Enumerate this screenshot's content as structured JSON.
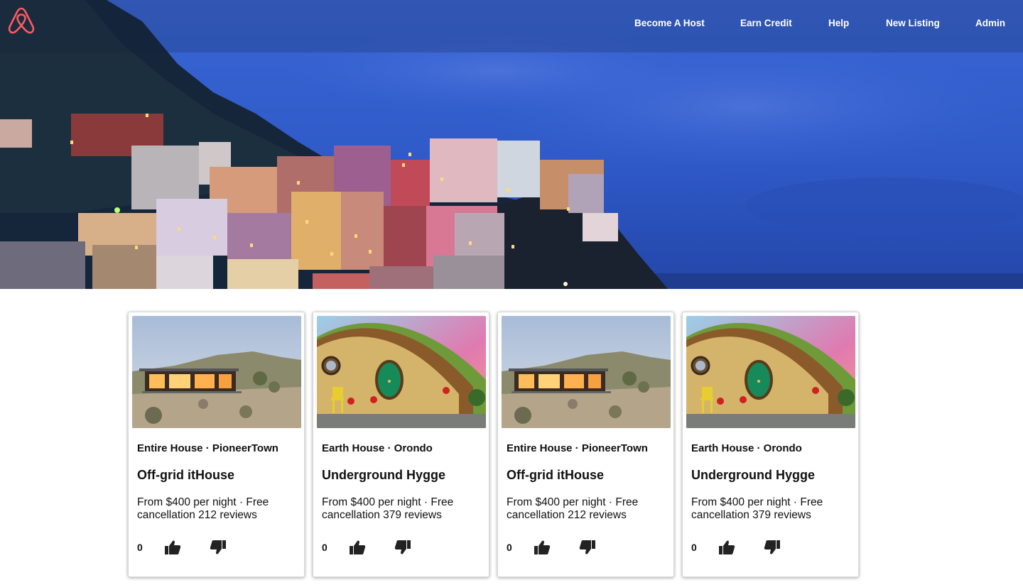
{
  "header": {
    "logo_icon": "airbnb-logo-icon",
    "nav": [
      "Become A Host",
      "Earn Credit",
      "Help",
      "New Listing",
      "Admin"
    ]
  },
  "colors": {
    "brand": "#ff5a5f",
    "nav_text": "#ffffff"
  },
  "listings": [
    {
      "type": "Entire House · PioneerTown",
      "title": "Off-grid itHouse",
      "description": "From $400 per night · Free cancellation 212 reviews",
      "votes": "0",
      "image": "desert-house"
    },
    {
      "type": "Earth House · Orondo",
      "title": "Underground Hygge",
      "description": "From $400 per night · Free cancellation 379 reviews",
      "votes": "0",
      "image": "hobbit-house"
    },
    {
      "type": "Entire House · PioneerTown",
      "title": "Off-grid itHouse",
      "description": "From $400 per night · Free cancellation 212 reviews",
      "votes": "0",
      "image": "desert-house"
    },
    {
      "type": "Earth House · Orondo",
      "title": "Underground Hygge",
      "description": "From $400 per night · Free cancellation 379 reviews",
      "votes": "0",
      "image": "hobbit-house"
    }
  ]
}
